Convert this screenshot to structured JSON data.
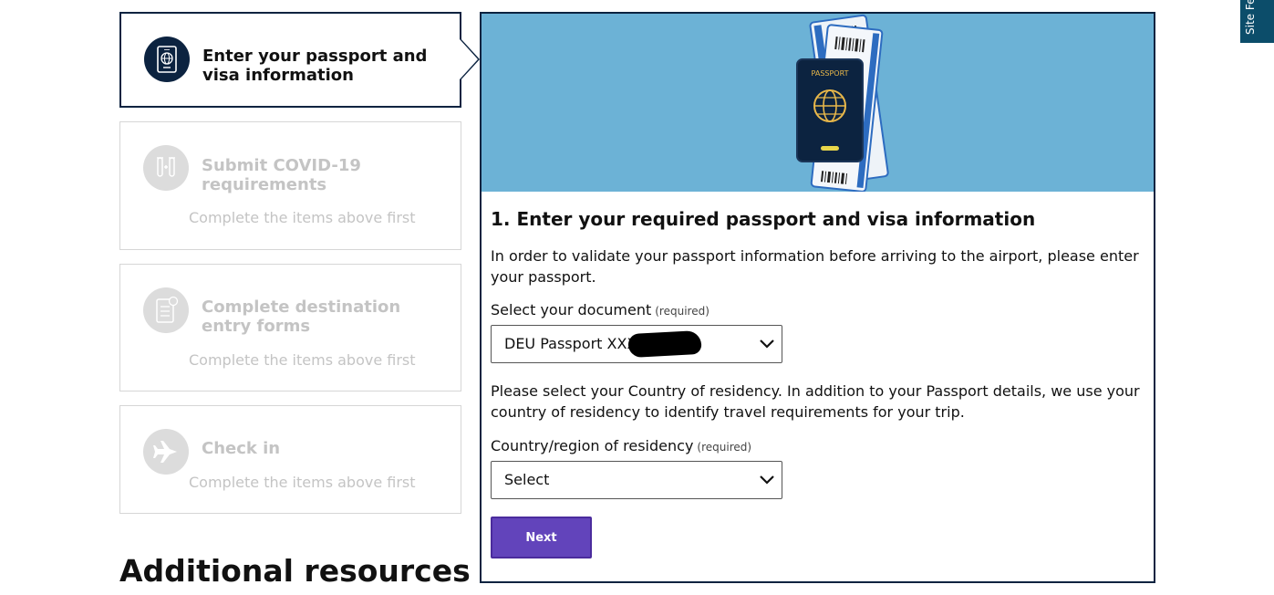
{
  "steps": [
    {
      "title": "Enter your passport and visa information",
      "hint": "",
      "icon": "passport-icon",
      "state": "active"
    },
    {
      "title": "Submit COVID-19 requirements",
      "hint": "Complete the items above first",
      "icon": "test-tubes-icon",
      "state": "disabled"
    },
    {
      "title": "Complete destination entry forms",
      "hint": "Complete the items above first",
      "icon": "form-checklist-icon",
      "state": "disabled"
    },
    {
      "title": "Check in",
      "hint": "Complete the items above first",
      "icon": "airplane-icon",
      "state": "disabled"
    }
  ],
  "additional_resources_heading": "Additional resources",
  "panel": {
    "hero_image": "passport-and-boarding-passes-illustration",
    "hero_passport_label": "PASSPORT",
    "title": "1. Enter your required passport and visa information",
    "description": "In order to validate your passport information before arriving to the airport, please enter your passport.",
    "document_label": "Select your document",
    "required_text": "(required)",
    "document_value": "DEU Passport XXX",
    "residency_description": "Please select your Country of residency. In addition to your Passport details, we use your country of residency to identify travel requirements for your trip.",
    "residency_label": "Country/region of residency",
    "residency_value": "Select",
    "next_label": "Next"
  },
  "feedback_tab": "Site Feedback",
  "colors": {
    "navy": "#0c2340",
    "hero_blue": "#6cb2d6",
    "button_purple": "#6244bb",
    "disabled_gray": "#c4c4c4",
    "feedback_teal": "#0c4d6a"
  }
}
